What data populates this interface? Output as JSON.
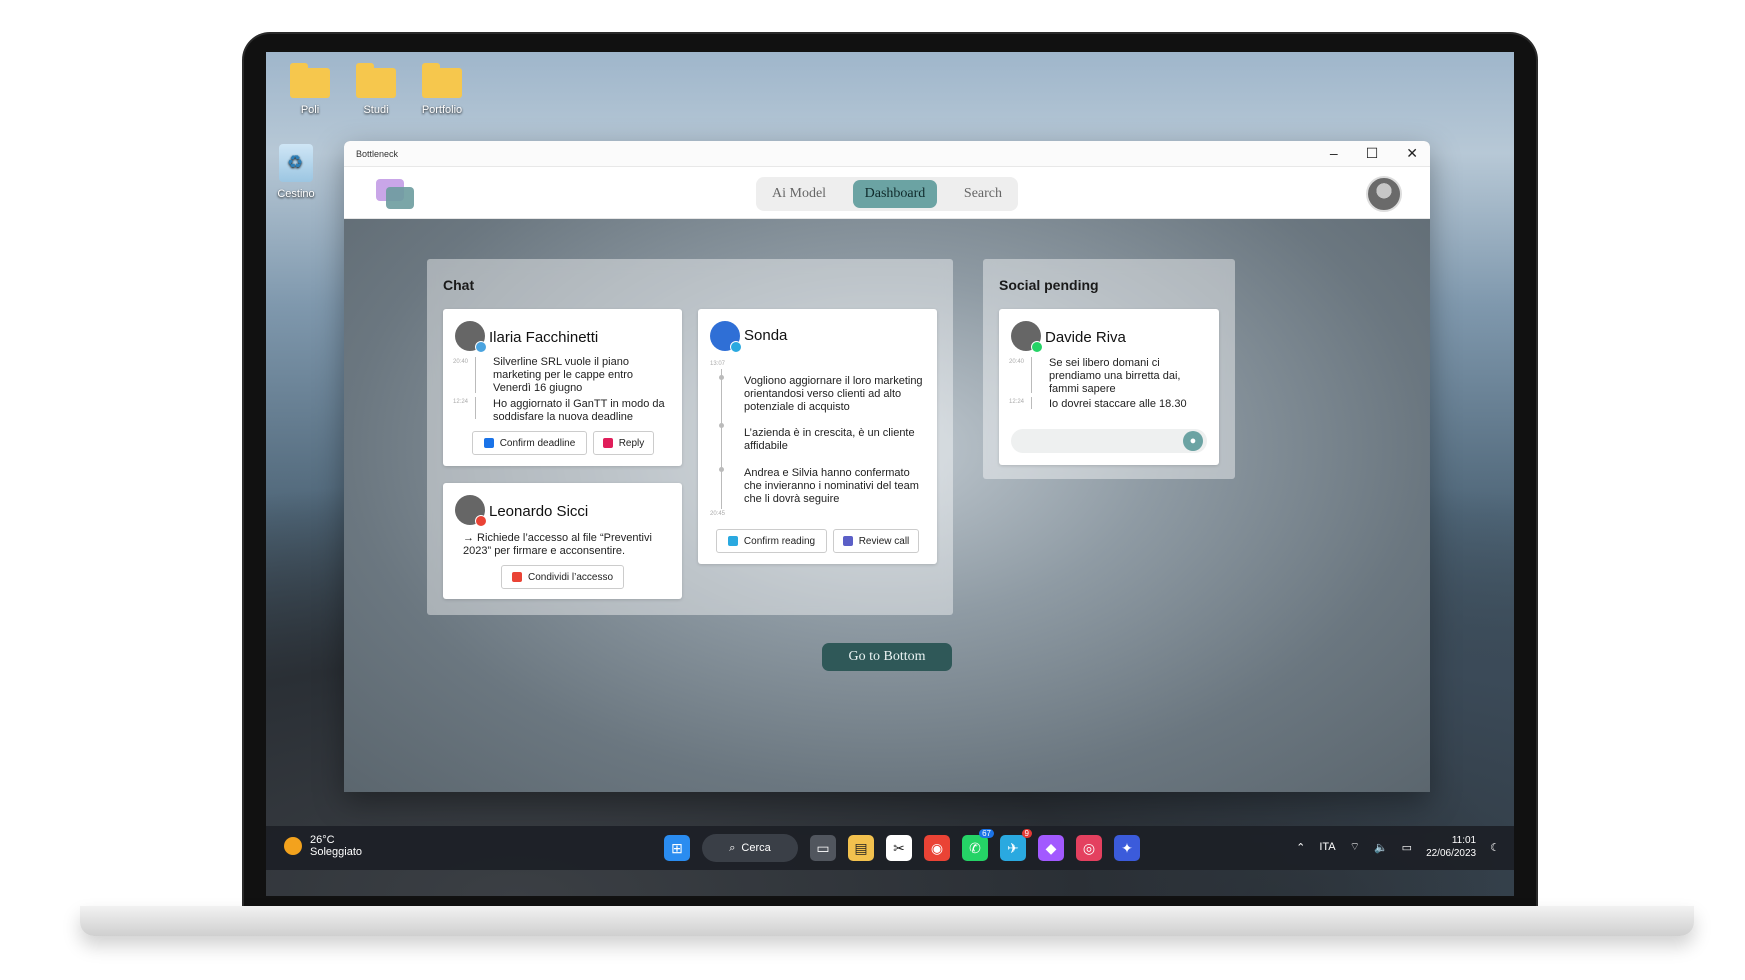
{
  "desktop": {
    "icons": [
      {
        "label": "Poli"
      },
      {
        "label": "Studi"
      },
      {
        "label": "Portfolio"
      },
      {
        "label": "Cestino"
      }
    ]
  },
  "window": {
    "title": "Bottleneck",
    "controls": {
      "minimize": "–",
      "maximize": "☐",
      "close": "✕"
    }
  },
  "appbar": {
    "tabs": [
      {
        "label": "Ai Model"
      },
      {
        "label": "Dashboard",
        "active": true
      },
      {
        "label": "Search"
      }
    ]
  },
  "chat": {
    "title": "Chat",
    "cards": [
      {
        "name": "Ilaria Facchinetti",
        "messages": [
          {
            "time": "20:40",
            "text": "Silverline SRL vuole il piano marketing per le cappe entro Venerdì 16 giugno"
          },
          {
            "time": "12:24",
            "text": "Ho aggiornato il GanTT in modo da soddisfare la nuova deadline"
          }
        ],
        "buttons": [
          {
            "label": "Confirm deadline"
          },
          {
            "label": "Reply"
          }
        ]
      },
      {
        "name": "Leonardo Sicci",
        "messages": [
          {
            "text": "→ Richiede l’accesso al file “Preventivi 2023” per firmare e acconsentire."
          }
        ],
        "buttons": [
          {
            "label": "Condividi l’accesso"
          }
        ]
      },
      {
        "name": "Sonda",
        "messages": [
          {
            "time": "13:07",
            "text": "Vogliono aggiornare il loro marketing orientandosi verso clienti ad alto potenziale di acquisto"
          },
          {
            "text": "L’azienda è in crescita, è un cliente affidabile"
          },
          {
            "text": "Andrea e Silvia hanno confermato che invieranno i nominativi del team che li dovrà seguire"
          },
          {
            "time": "20:45"
          }
        ],
        "buttons": [
          {
            "label": "Confirm reading"
          },
          {
            "label": "Review call"
          }
        ]
      }
    ]
  },
  "social": {
    "title": "Social pending",
    "card": {
      "name": "Davide Riva",
      "messages": [
        {
          "time": "20:40",
          "text": "Se sei libero domani ci prendiamo una birretta dai, fammi sapere"
        },
        {
          "time": "12:24",
          "text": "Io dovrei staccare alle 18.30"
        }
      ],
      "input": {
        "placeholder": ""
      }
    }
  },
  "main": {
    "go_bottom": "Go to Bottom"
  },
  "taskbar": {
    "weather": {
      "temp": "26°C",
      "desc": "Soleggiato"
    },
    "search": "Cerca",
    "whatsapp_badge": "67",
    "telegram_badge": "9",
    "lang": "ITA",
    "time": "11:01",
    "date": "22/06/2023"
  },
  "colors": {
    "accent": "#6ba3a3",
    "button_dark": "#2f5858"
  }
}
